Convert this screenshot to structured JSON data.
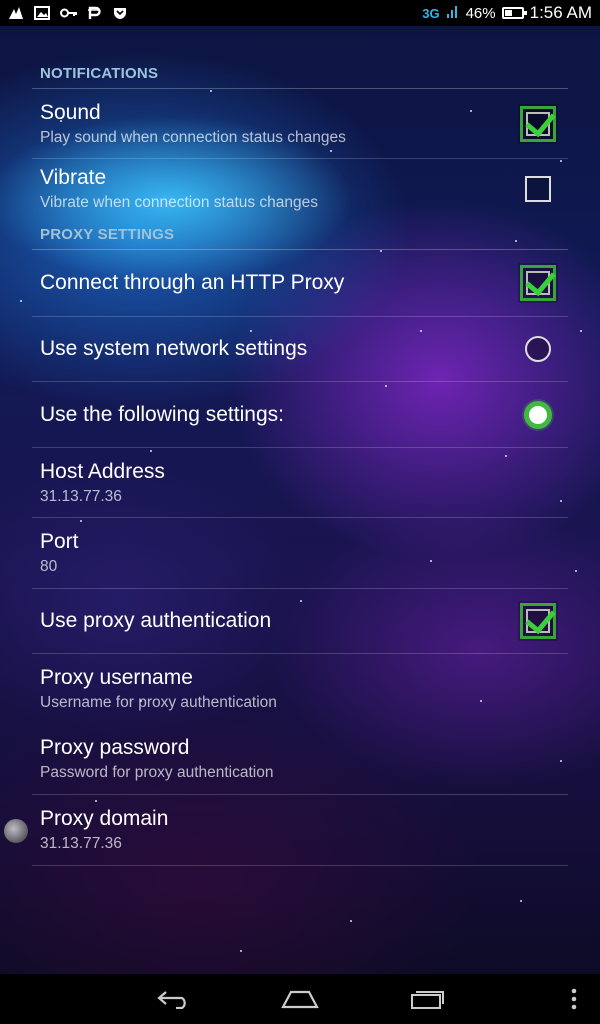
{
  "status_bar": {
    "left_icons": [
      "signal-cleanup-icon",
      "image-icon",
      "key-icon",
      "p-app-icon",
      "shield-icon"
    ],
    "network": "3G",
    "battery": "46%",
    "battery_level": 46,
    "time": "1:56 AM"
  },
  "sections": {
    "notifications": "NOTIFICATIONS",
    "proxy": "PROXY SETTINGS"
  },
  "items": {
    "sound": {
      "title": "Sound",
      "summary": "Play sound when connection status changes",
      "checked": true
    },
    "vibrate": {
      "title": "Vibrate",
      "summary": "Vibrate when connection status changes",
      "checked": false
    },
    "http_proxy": {
      "title": "Connect through an HTTP Proxy",
      "checked": true
    },
    "system_settings": {
      "title": "Use system network settings",
      "selected": false
    },
    "following_settings": {
      "title": "Use the following settings:",
      "selected": true
    },
    "host": {
      "title": "Host Address",
      "value": "31.13.77.36"
    },
    "port": {
      "title": "Port",
      "value": "80"
    },
    "proxy_auth": {
      "title": "Use proxy authentication",
      "checked": true
    },
    "proxy_username": {
      "title": "Proxy username",
      "summary": "Username for proxy authentication"
    },
    "proxy_password": {
      "title": "Proxy password",
      "summary": "Password for proxy authentication"
    },
    "proxy_domain": {
      "title": "Proxy domain",
      "value": "31.13.77.36"
    }
  },
  "nav_bar": {
    "buttons": [
      "back-icon",
      "home-icon",
      "recents-icon",
      "overflow-menu-icon"
    ]
  },
  "colors": {
    "section_header": "#9ec3dc",
    "check_green": "#3ad03a",
    "radio_green": "#42b842",
    "network_blue": "#33b5e5"
  }
}
